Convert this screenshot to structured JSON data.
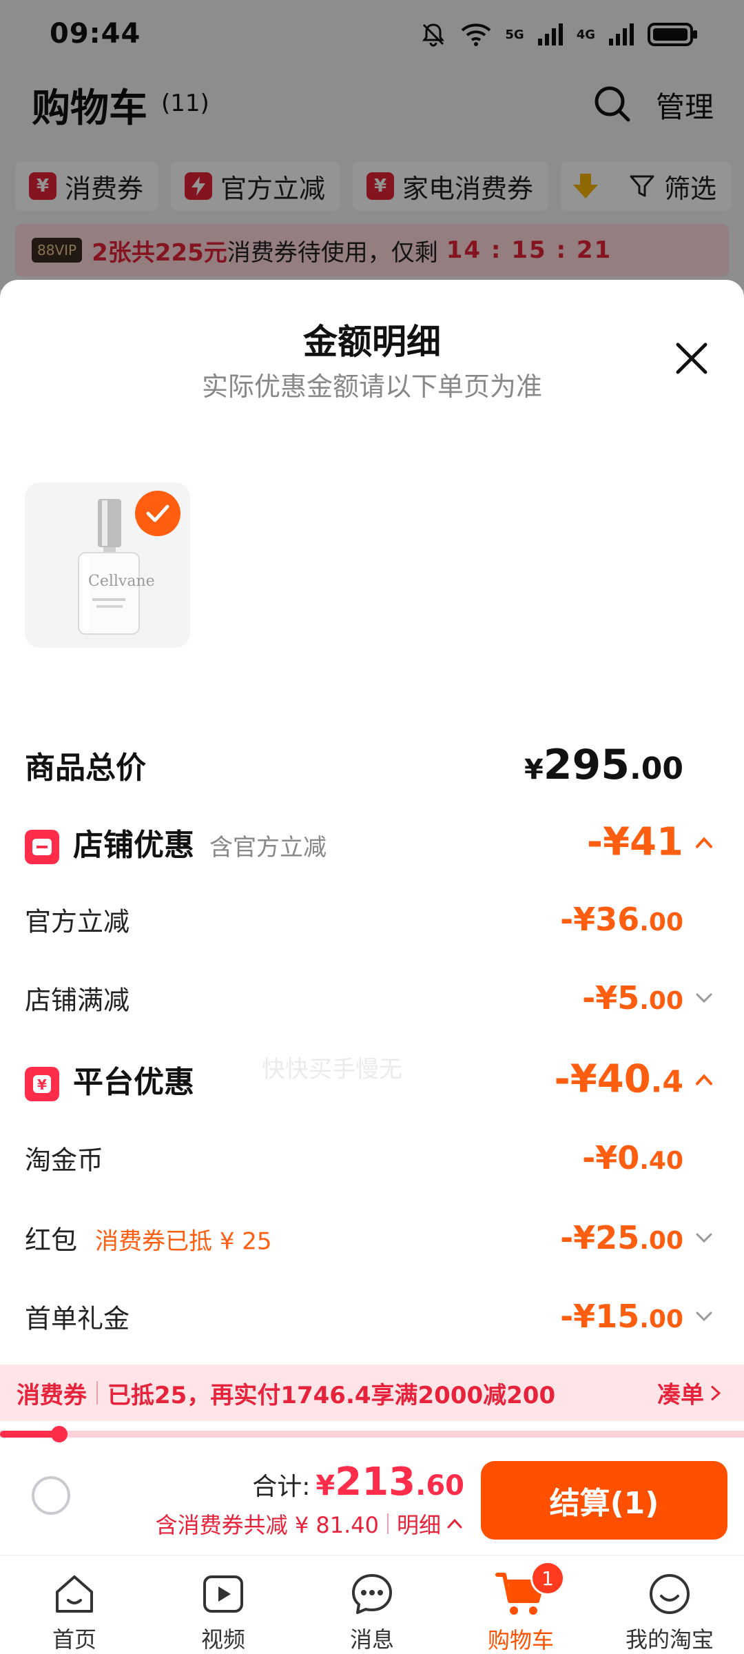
{
  "status": {
    "time": "09:44",
    "net1": "5G",
    "net2": "4G"
  },
  "cart": {
    "title": "购物车",
    "count": "(11)",
    "manage": "管理"
  },
  "chips": {
    "coupon": "消费券",
    "official": "官方立减",
    "appliance": "家电消费券",
    "filter": "筛选"
  },
  "vip": {
    "tag": "88VIP",
    "highlight": "2张共225元",
    "text": "消费券待使用，仅剩",
    "timer": "14 : 15 : 21"
  },
  "sheet": {
    "title": "金额明细",
    "subtitle": "实际优惠金额请以下单页为准",
    "watermark": "快快买手慢无",
    "product": {
      "brand": "Cellvane"
    }
  },
  "rows": {
    "total": {
      "label": "商品总价",
      "symbol": "¥",
      "int": "295",
      "dec": ".00"
    },
    "shop": {
      "label": "店铺优惠",
      "note": "含官方立减",
      "int": "-¥41",
      "dec": ""
    },
    "official": {
      "label": "官方立减",
      "int": "-¥36",
      "dec": ".00"
    },
    "shop_full": {
      "label": "店铺满减",
      "int": "-¥5",
      "dec": ".00"
    },
    "platform": {
      "label": "平台优惠",
      "int": "-¥40",
      "dec": ".4"
    },
    "gold": {
      "label": "淘金币",
      "int": "-¥0",
      "dec": ".40"
    },
    "redpack": {
      "label": "红包",
      "note": "消费券已抵 ¥ 25",
      "int": "-¥25",
      "dec": ".00"
    },
    "first": {
      "label": "首单礼金",
      "int": "-¥15",
      "dec": ".00"
    }
  },
  "coupon_bar": {
    "tag": "消费券",
    "message": "已抵25，再实付1746.4享满2000减200",
    "link": "凑单",
    "progress": 0.08
  },
  "checkout": {
    "label": "合计:",
    "symbol": "¥",
    "int": "213",
    "dec": ".60",
    "saving": "含消费券共减 ¥ 81.40",
    "detail": "明细",
    "button": "结算(1)"
  },
  "tabs": [
    {
      "label": "首页",
      "icon": "home-icon"
    },
    {
      "label": "视频",
      "icon": "video-icon"
    },
    {
      "label": "消息",
      "icon": "message-icon"
    },
    {
      "label": "购物车",
      "icon": "cart-icon",
      "badge": "1"
    },
    {
      "label": "我的淘宝",
      "icon": "profile-icon"
    }
  ],
  "colors": {
    "accent": "#ff5000",
    "red": "#ff2d4a",
    "orange_text": "#ff5d0f"
  }
}
